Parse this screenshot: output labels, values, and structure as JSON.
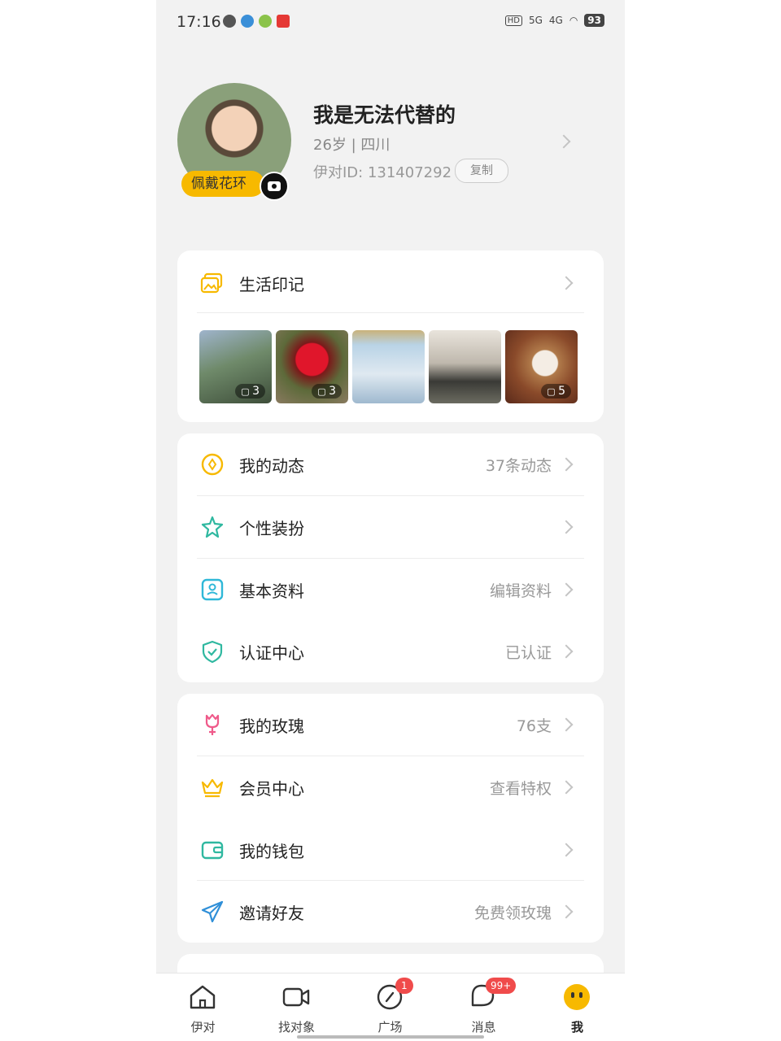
{
  "status_bar": {
    "time": "17:16",
    "network_1": "5G",
    "network_2": "4G",
    "battery": "93"
  },
  "profile": {
    "name": "我是无法代替的",
    "info": "26岁 | 四川",
    "id_text": "伊对ID: 131407292",
    "copy_label": "复制",
    "wreath_label": "佩戴花环"
  },
  "life_album": {
    "title": "生活印记",
    "photos": [
      {
        "desc": "tree",
        "count": "3"
      },
      {
        "desc": "rose",
        "count": "3"
      },
      {
        "desc": "game",
        "count": ""
      },
      {
        "desc": "shoes",
        "count": ""
      },
      {
        "desc": "cat",
        "count": "5"
      }
    ]
  },
  "menu_group_1": [
    {
      "label": "我的动态",
      "value": "37条动态",
      "icon": "compass-icon"
    },
    {
      "label": "个性装扮",
      "value": "",
      "icon": "star-icon"
    },
    {
      "label": "基本资料",
      "value": "编辑资料",
      "icon": "id-card-icon"
    },
    {
      "label": "认证中心",
      "value": "已认证",
      "icon": "shield-icon"
    }
  ],
  "menu_group_2": [
    {
      "label": "我的玫瑰",
      "value": "76支",
      "icon": "rose-icon"
    },
    {
      "label": "会员中心",
      "value": "查看特权",
      "icon": "crown-icon"
    },
    {
      "label": "我的钱包",
      "value": "",
      "icon": "wallet-icon"
    },
    {
      "label": "邀请好友",
      "value": "免费领玫瑰",
      "icon": "send-icon"
    }
  ],
  "tab_bar": [
    {
      "label": "伊对",
      "icon": "home-icon",
      "badge": ""
    },
    {
      "label": "找对象",
      "icon": "video-icon",
      "badge": ""
    },
    {
      "label": "广场",
      "icon": "discover-icon",
      "badge": "1"
    },
    {
      "label": "消息",
      "icon": "message-icon",
      "badge": "99+"
    },
    {
      "label": "我",
      "icon": "me-icon",
      "badge": ""
    }
  ],
  "colors": {
    "accent": "#f7b900",
    "badge": "#f04b4b",
    "background": "#f2f2f2"
  }
}
